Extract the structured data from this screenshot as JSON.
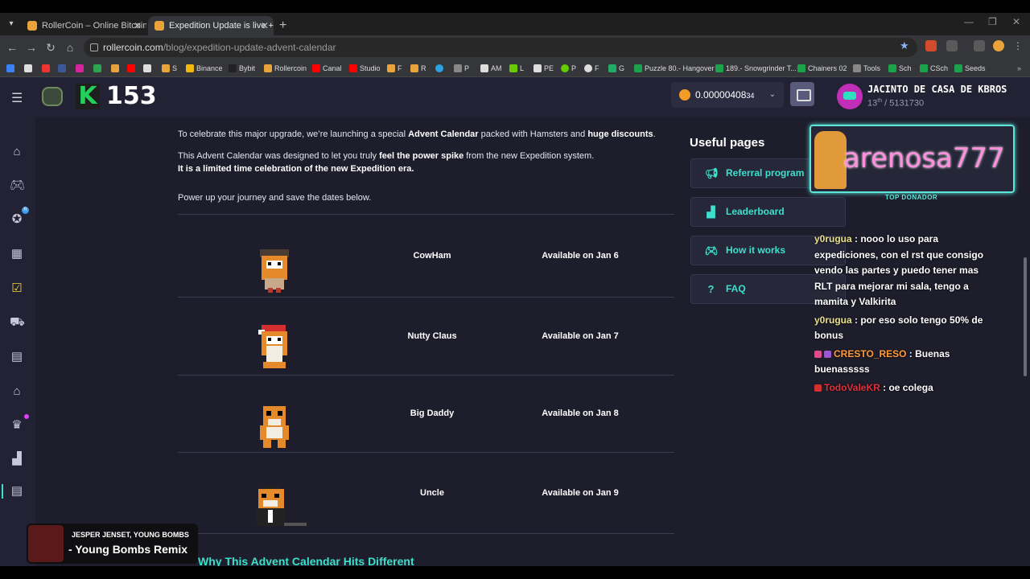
{
  "browser": {
    "tabs": [
      {
        "title": "RollerCoin – Online Bitcoin Mining",
        "active": false
      },
      {
        "title": "Expedition Update is live + Advent",
        "active": true
      }
    ],
    "url_host": "rollercoin.com",
    "url_path": "/blog/expedition-update-advent-calendar",
    "bookmarks": [
      "S",
      "Binance",
      "Bybit",
      "Rollercoin",
      "Canal",
      "Studio",
      "F",
      "R",
      "P",
      "AM",
      "L",
      "PE",
      "P",
      "F",
      "G",
      "Puzzle 80.- Hangover",
      "189.- Snowgrinder T...",
      "Chainers 02",
      "Tools",
      "Sch",
      "CSch",
      "Seeds"
    ]
  },
  "header": {
    "k_count": "153",
    "balance_main": "0.00000408",
    "balance_small": "34",
    "username": "JACINTO DE CASA DE KBROS",
    "rank_pos": "13",
    "rank_suffix": "th",
    "rank_total": " / 5131730"
  },
  "article": {
    "p1_a": "To celebrate this major upgrade, we’re launching a special ",
    "p1_b": "Advent Calendar",
    "p1_c": " packed with Hamsters and ",
    "p1_d": "huge discounts",
    "p1_e": ".",
    "p2_a": "This Advent Calendar was designed to let you truly ",
    "p2_b": "feel the power spike",
    "p2_c": " from the new Expedition system.",
    "p3": "It is a limited time celebration of the new Expedition era.",
    "p4": "Power up your journey and save the dates below.",
    "rows": [
      {
        "name": "CowHam",
        "date": "Available on Jan 6"
      },
      {
        "name": "Nutty Claus",
        "date": "Available on Jan 7"
      },
      {
        "name": "Big Daddy",
        "date": "Available on Jan 8"
      },
      {
        "name": "Uncle",
        "date": "Available on Jan 9"
      }
    ],
    "heading": "Why This Advent Calendar Hits Different"
  },
  "useful": {
    "title": "Useful pages",
    "items": [
      "Referral program",
      "Leaderboard",
      "How it works",
      "FAQ"
    ]
  },
  "stream": {
    "donor_name": "arenosa777",
    "donor_label": "TOP DONADOR",
    "chat": [
      {
        "user": "y0rugua",
        "text": " : nooo lo uso para expediciones, con el rst que consigo vendo las partes y puedo tener mas RLT para mejorar mi sala, tengo a mamita y Valkirita"
      },
      {
        "user": "y0rugua",
        "text": " : por eso solo tengo 50% de bonus"
      },
      {
        "user": "CRESTO_RESO",
        "text": " : Buenas buenasssss"
      },
      {
        "user": "TodoValeKR",
        "text": " : oe colega"
      }
    ],
    "music_artist": "JESPER JENSET, YOUNG BOMBS",
    "music_title": "- Young Bombs Remix"
  },
  "colors": {
    "accent": "#3de0cc",
    "bg": "#1d1d2b",
    "panel": "#222234"
  }
}
